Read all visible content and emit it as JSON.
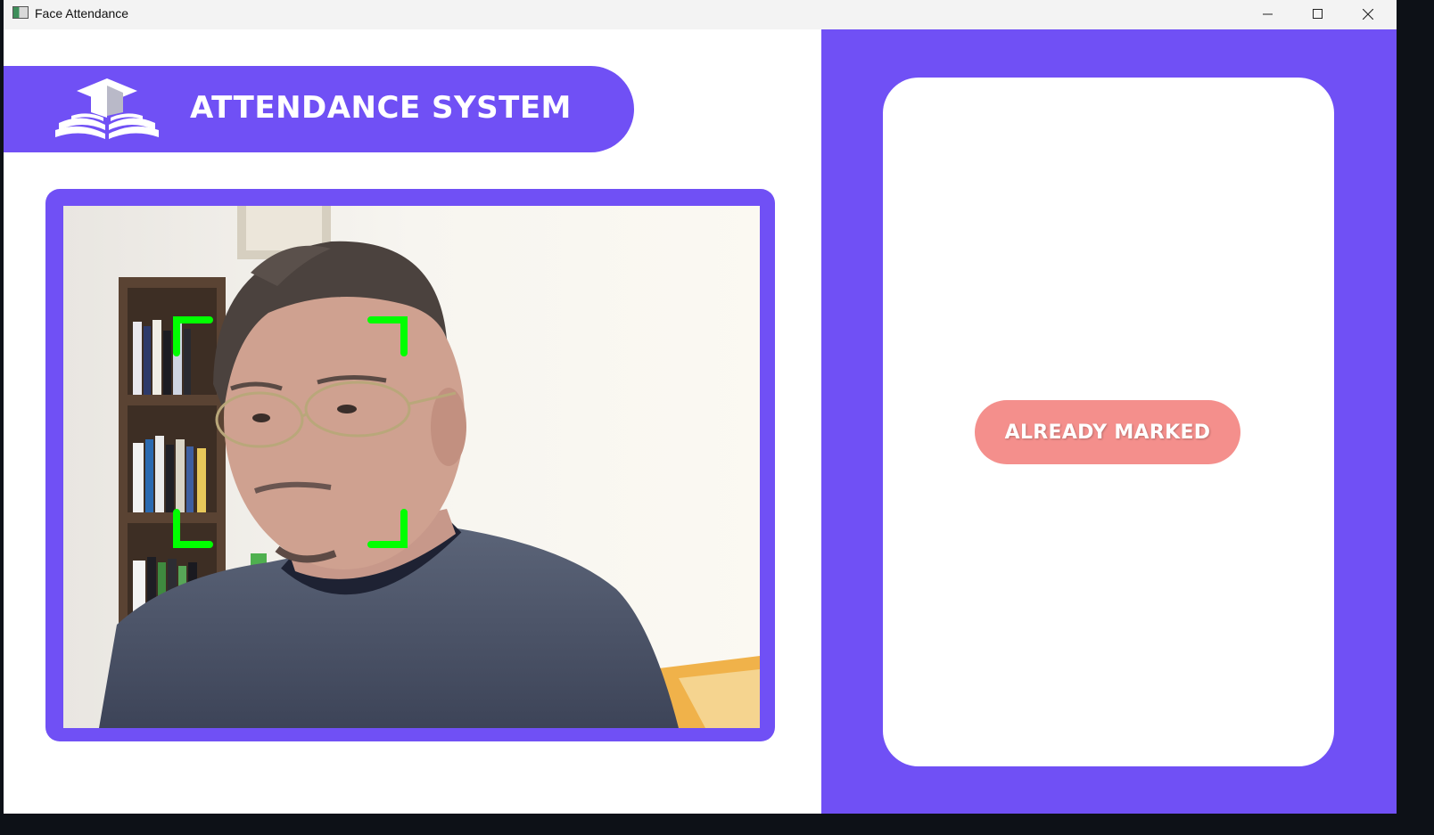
{
  "window": {
    "title": "Face Attendance",
    "icon": "app-window-icon",
    "controls": {
      "minimize_icon": "minimize-icon",
      "maximize_icon": "maximize-icon",
      "close_icon": "close-icon"
    }
  },
  "header": {
    "title": "ATTENDANCE SYSTEM",
    "logo_icon": "graduation-cap-book-icon"
  },
  "camera": {
    "feed": "webcam-feed",
    "face_marker_color": "#00ff00"
  },
  "status": {
    "label": "ALREADY MARKED",
    "color": "#f48f8c"
  },
  "colors": {
    "accent": "#7050f5",
    "card": "#ffffff",
    "status_text": "#ffffff"
  }
}
